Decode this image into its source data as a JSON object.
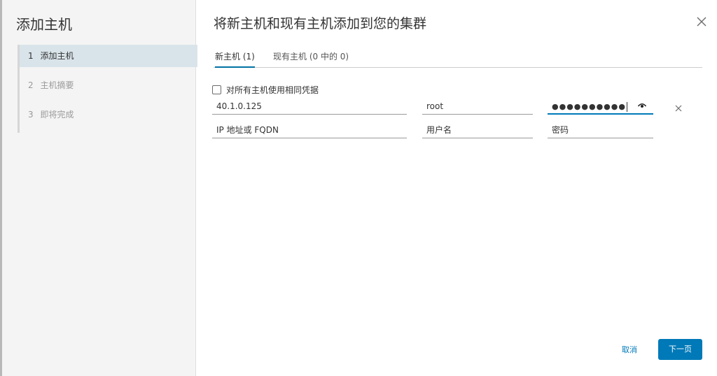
{
  "sidebar": {
    "title": "添加主机",
    "steps": [
      {
        "num": "1",
        "label": "添加主机",
        "active": true
      },
      {
        "num": "2",
        "label": "主机摘要",
        "active": false
      },
      {
        "num": "3",
        "label": "即将完成",
        "active": false
      }
    ]
  },
  "header": {
    "title": "将新主机和现有主机添加到您的集群",
    "close_icon": "close-icon"
  },
  "tabs": [
    {
      "label": "新主机 (1)",
      "active": true
    },
    {
      "label": "现有主机 (0 中的 0)",
      "active": false
    }
  ],
  "same_credentials": {
    "label": "对所有主机使用相同凭据",
    "checked": false
  },
  "host_row": {
    "ip_value": "40.1.0.125",
    "username_value": "root",
    "password_value": "●●●●●●●●●●",
    "eye_icon": "eye-icon",
    "remove_icon": "close-icon"
  },
  "placeholders": {
    "ip": "IP 地址或 FQDN",
    "username": "用户名",
    "password": "密码"
  },
  "footer": {
    "cancel_label": "取消",
    "next_label": "下一页"
  },
  "colors": {
    "accent": "#0079b8",
    "active_step_bg": "#d9e4ea"
  }
}
